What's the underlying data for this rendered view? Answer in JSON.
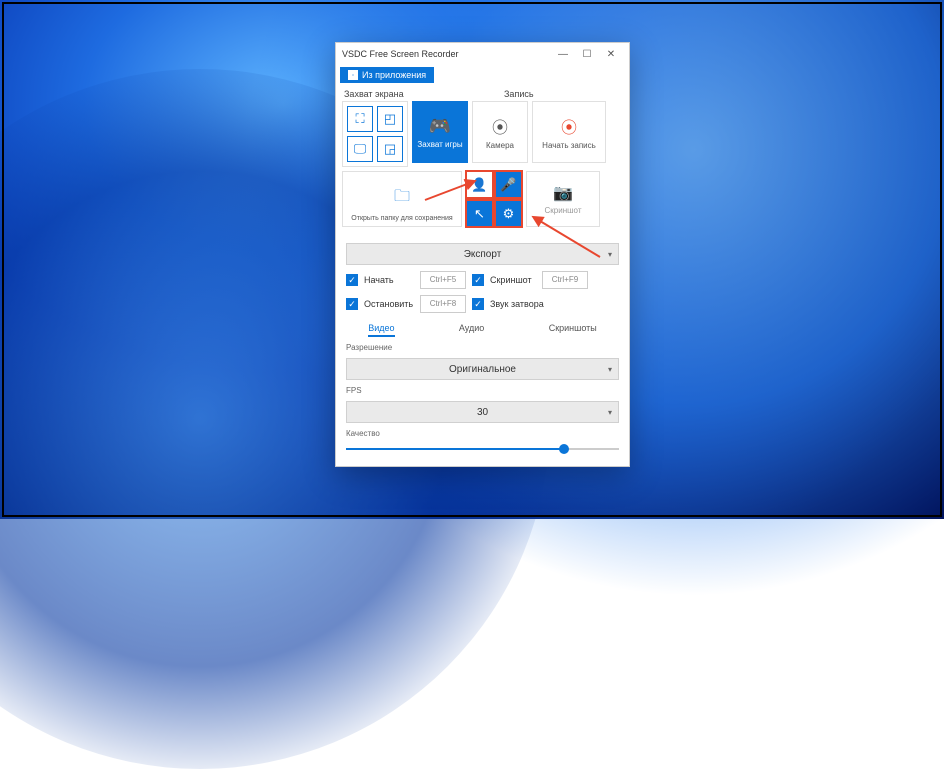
{
  "window_title": "VSDC Free Screen Recorder",
  "ribbon_tab": "Из приложения",
  "section_capture": "Захват экрана",
  "section_record": "Запись",
  "tile_game": "Захват игры",
  "tile_camera": "Камера",
  "tile_start_record": "Начать запись",
  "tile_open_folder": "Открыть папку для сохранения",
  "tile_screenshot": "Скриншот",
  "export_label": "Экспорт",
  "chk_start": "Начать",
  "chk_stop": "Остановить",
  "chk_screenshot": "Скриншот",
  "chk_shutter": "Звук затвора",
  "hk_start": "Ctrl+F5",
  "hk_stop": "Ctrl+F8",
  "hk_shot": "Ctrl+F9",
  "tab_video": "Видео",
  "tab_audio": "Аудио",
  "tab_shots": "Скриншоты",
  "lbl_resolution": "Разрешение",
  "val_resolution": "Оригинальное",
  "lbl_fps": "FPS",
  "val_fps": "30",
  "lbl_quality": "Качество",
  "quality_percent": 80
}
